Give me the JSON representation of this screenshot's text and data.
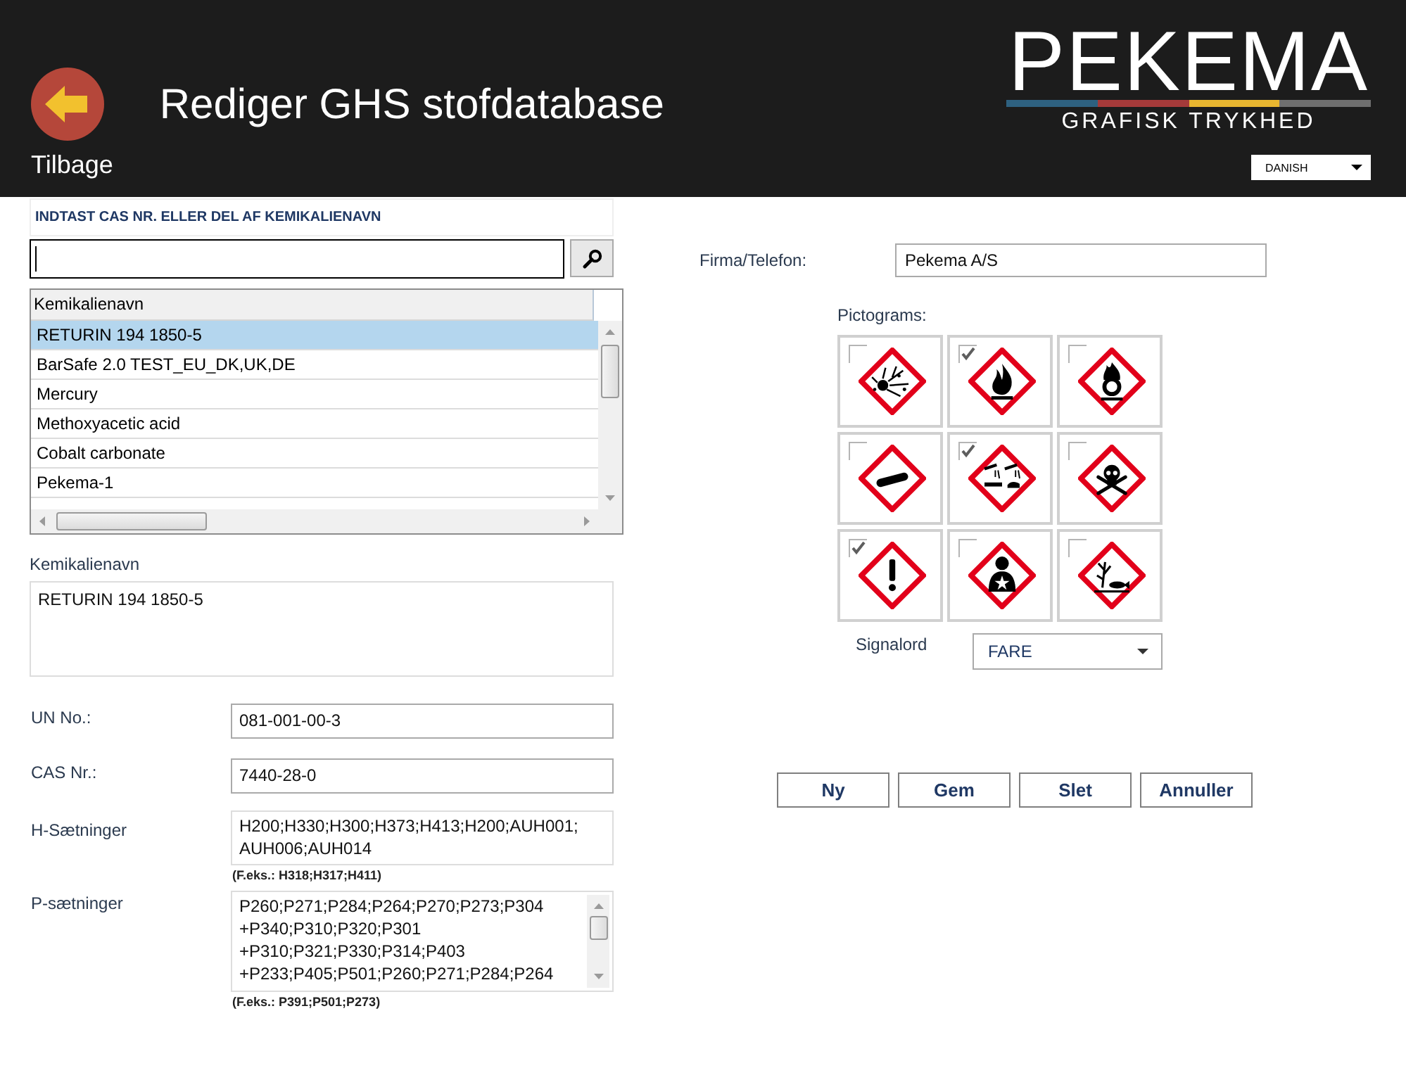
{
  "header": {
    "back_label": "Tilbage",
    "title": "Rediger GHS stofdatabase",
    "logo": {
      "wordmark": "PEKEMA",
      "tagline": "GRAFISK TRYKHED"
    },
    "language": "DANISH"
  },
  "search": {
    "heading": "INDTAST CAS NR. ELLER DEL AF KEMIKALIENAVN"
  },
  "results_table": {
    "columns": [
      "Kemikalienavn"
    ],
    "rows": [
      {
        "name": "RETURIN 194 1850-5",
        "selected": true
      },
      {
        "name": "BarSafe 2.0 TEST_EU_DK,UK,DE",
        "selected": false
      },
      {
        "name": "Mercury",
        "selected": false
      },
      {
        "name": "Methoxyacetic acid",
        "selected": false
      },
      {
        "name": "Cobalt carbonate",
        "selected": false
      },
      {
        "name": "Pekema-1",
        "selected": false
      }
    ]
  },
  "details": {
    "chemical_name": {
      "label": "Kemikalienavn",
      "value": "RETURIN 194 1850-5"
    },
    "un_no": {
      "label": "UN No.:",
      "value": "081-001-00-3"
    },
    "cas_nr": {
      "label": "CAS Nr.:",
      "value": "7440-28-0"
    },
    "h_statements": {
      "label": "H-Sætninger",
      "lines": [
        "H200;H330;H300;H373;H413;H200;AUH001;",
        "AUH006;AUH014"
      ],
      "hint": "(F.eks.: H318;H317;H411)"
    },
    "p_statements": {
      "label": "P-sætninger",
      "lines": [
        "P260;P271;P284;P264;P270;P273;P304",
        "+P340;P310;P320;P301",
        "+P310;P321;P330;P314;P403",
        "+P233;P405;P501;P260;P271;P284;P264"
      ],
      "hint": "(F.eks.: P391;P501;P273)"
    }
  },
  "company": {
    "label": "Firma/Telefon:",
    "value": "Pekema A/S"
  },
  "pictograms": {
    "label": "Pictograms:",
    "items": [
      {
        "kind": "explosive",
        "checked": false
      },
      {
        "kind": "flammable",
        "checked": true
      },
      {
        "kind": "oxidizing",
        "checked": false
      },
      {
        "kind": "gas",
        "checked": false
      },
      {
        "kind": "corrosive",
        "checked": true
      },
      {
        "kind": "toxic",
        "checked": false
      },
      {
        "kind": "irritant",
        "checked": true
      },
      {
        "kind": "health",
        "checked": false
      },
      {
        "kind": "environment",
        "checked": false
      }
    ]
  },
  "signal_word": {
    "label": "Signalord",
    "value": "FARE"
  },
  "buttons": [
    "Ny",
    "Gem",
    "Slet",
    "Annuller"
  ]
}
